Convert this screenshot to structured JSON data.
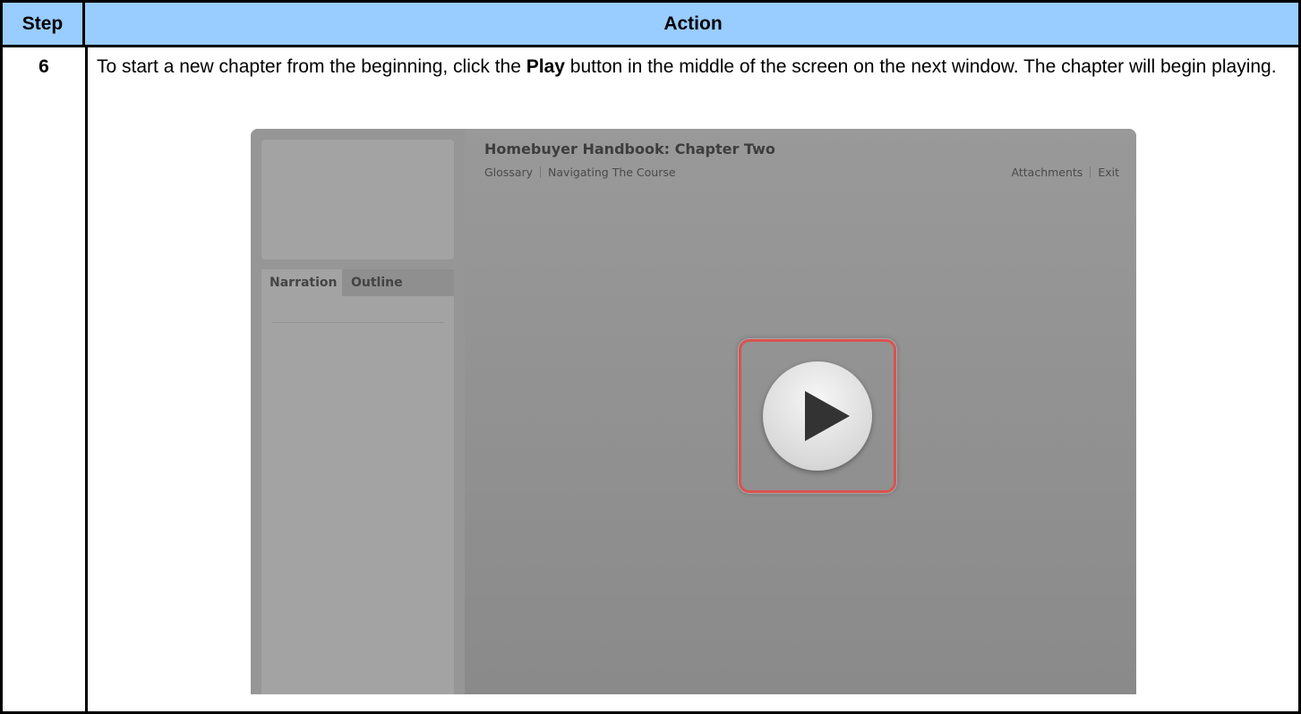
{
  "table": {
    "header_step": "Step",
    "header_action": "Action",
    "step_number": "6",
    "instruction_before": "To start a new chapter from the beginning, click the ",
    "instruction_bold": "Play",
    "instruction_after": " button in the middle of the screen on the next window. The chapter will begin playing."
  },
  "player": {
    "title": "Homebuyer Handbook: Chapter Two",
    "menu_left": [
      "Glossary",
      "Navigating The Course"
    ],
    "menu_right": [
      "Attachments",
      "Exit"
    ],
    "tabs": [
      "Narration",
      "Outline"
    ],
    "play_icon": "play-icon",
    "highlight_color": "#d9534f"
  },
  "colors": {
    "header_bg": "#99ccff",
    "player_bg": "#8d8d8d"
  }
}
